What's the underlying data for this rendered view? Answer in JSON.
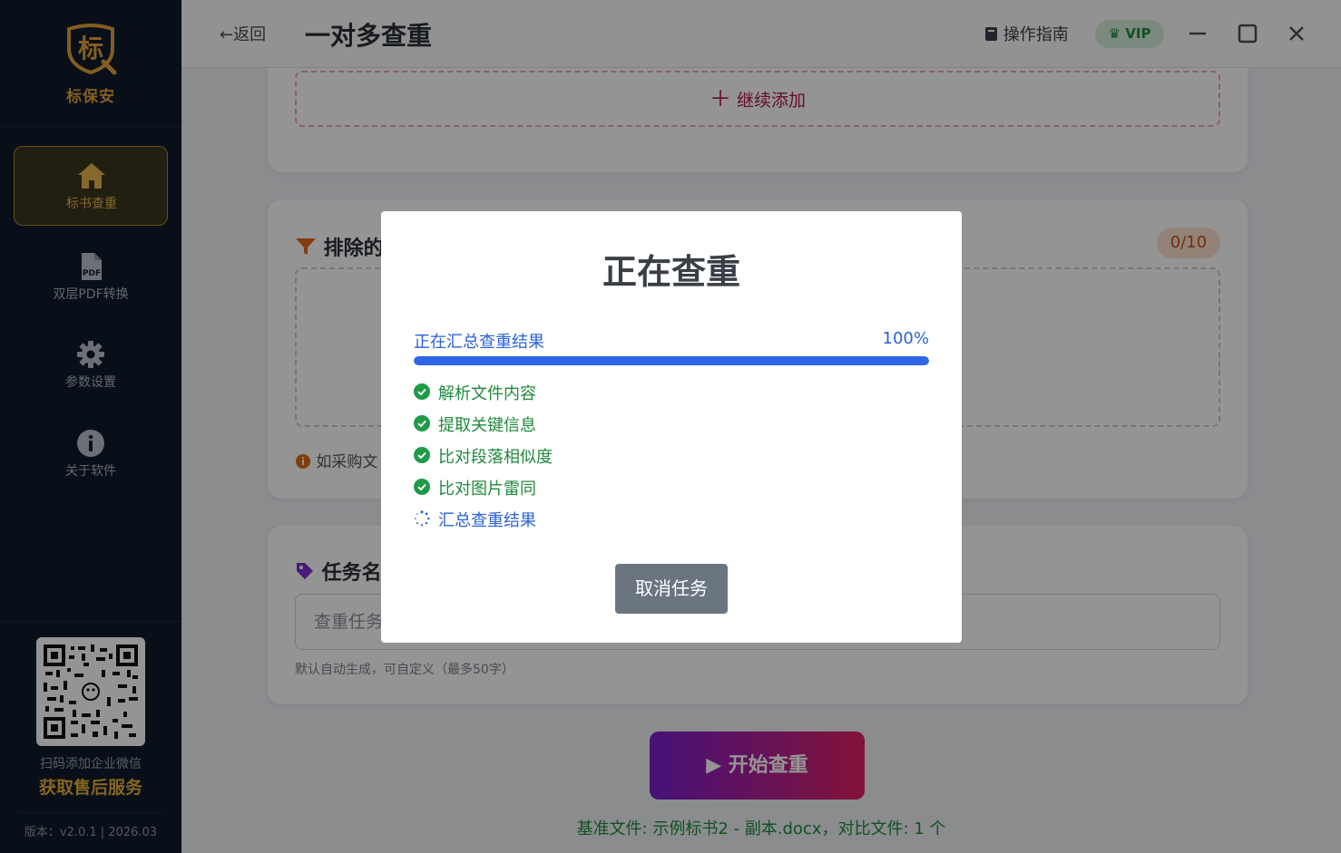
{
  "sidebar": {
    "logo_glyph": "标",
    "logo_text": "标保安",
    "items": [
      {
        "label": "标书查重",
        "icon": "home-icon",
        "active": true
      },
      {
        "label": "双层PDF转换",
        "icon": "pdf-file-icon"
      },
      {
        "label": "参数设置",
        "icon": "gear-icon"
      },
      {
        "label": "关于软件",
        "icon": "info-icon"
      }
    ],
    "qr_tip": "扫码添加企业微信",
    "qr_cta": "获取售后服务",
    "version": "版本：v2.0.1 | 2026.03"
  },
  "header": {
    "back_label": "返回",
    "title": "一对多查重",
    "guide_label": "操作指南",
    "vip_label": "VIP"
  },
  "main": {
    "add_more_label": "继续添加",
    "exclude_title": "排除的",
    "exclude_count": "0/10",
    "exclude_info": "如采购文",
    "task_title": "任务名",
    "task_placeholder": "查重任务",
    "task_hint": "默认自动生成，可自定义（最多50字）",
    "start_label": "开始查重",
    "status_line": "基准文件: 示例标书2 - 副本.docx，对比文件: 1 个"
  },
  "modal": {
    "title": "正在查重",
    "progress_label": "正在汇总查重结果",
    "progress_percent": "100%",
    "progress_value": 1.0,
    "steps": [
      {
        "label": "解析文件内容",
        "state": "done"
      },
      {
        "label": "提取关键信息",
        "state": "done"
      },
      {
        "label": "比对段落相似度",
        "state": "done"
      },
      {
        "label": "比对图片雷同",
        "state": "done"
      },
      {
        "label": "汇总查重结果",
        "state": "active"
      }
    ],
    "cancel_label": "取消任务"
  },
  "colors": {
    "accent_gold": "#e0a33a",
    "progress_blue": "#2d67e8",
    "success_green": "#1f8a3b",
    "start_gradient_from": "#7a1fd0",
    "start_gradient_to": "#e01f63"
  }
}
